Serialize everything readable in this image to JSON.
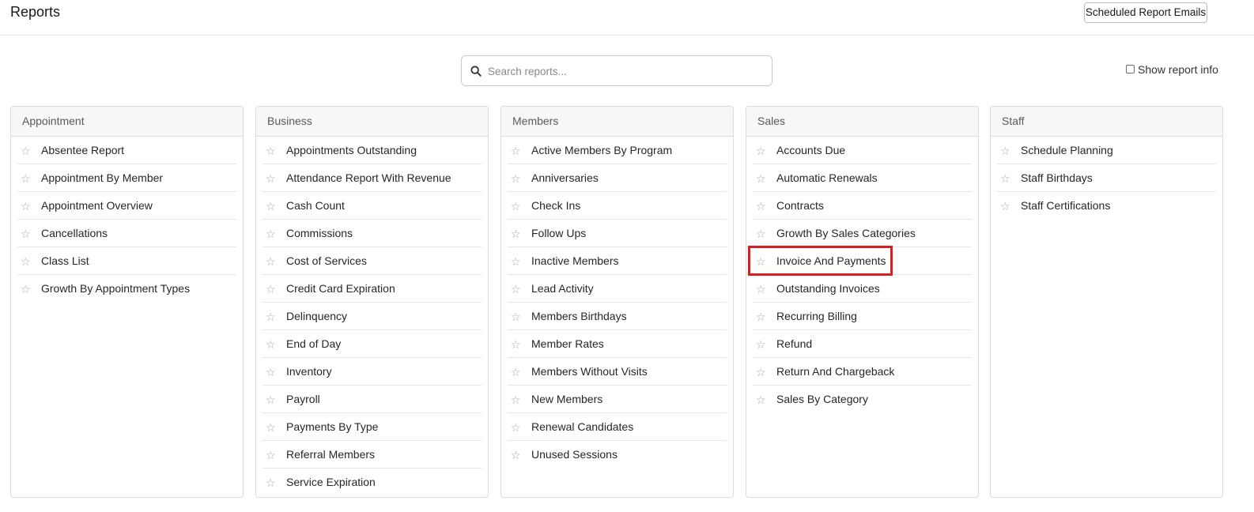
{
  "header": {
    "title": "Reports",
    "scheduled_button": "Scheduled Report Emails"
  },
  "search": {
    "placeholder": "Search reports...",
    "value": ""
  },
  "show_info": {
    "label": "Show report info",
    "checked": false
  },
  "highlight_color": "#d62020",
  "categories": [
    {
      "name": "Appointment",
      "items": [
        "Absentee Report",
        "Appointment By Member",
        "Appointment Overview",
        "Cancellations",
        "Class List",
        "Growth By Appointment Types"
      ]
    },
    {
      "name": "Business",
      "items": [
        "Appointments Outstanding",
        "Attendance Report With Revenue",
        "Cash Count",
        "Commissions",
        "Cost of Services",
        "Credit Card Expiration",
        "Delinquency",
        "End of Day",
        "Inventory",
        "Payroll",
        "Payments By Type",
        "Referral Members",
        "Service Expiration"
      ]
    },
    {
      "name": "Members",
      "items": [
        "Active Members By Program",
        "Anniversaries",
        "Check Ins",
        "Follow Ups",
        "Inactive Members",
        "Lead Activity",
        "Members Birthdays",
        "Member Rates",
        "Members Without Visits",
        "New Members",
        "Renewal Candidates",
        "Unused Sessions"
      ]
    },
    {
      "name": "Sales",
      "items": [
        "Accounts Due",
        "Automatic Renewals",
        "Contracts",
        "Growth By Sales Categories",
        "Invoice And Payments",
        "Outstanding Invoices",
        "Recurring Billing",
        "Refund",
        "Return And Chargeback",
        "Sales By Category"
      ]
    },
    {
      "name": "Staff",
      "items": [
        "Schedule Planning",
        "Staff Birthdays",
        "Staff Certifications"
      ]
    }
  ]
}
